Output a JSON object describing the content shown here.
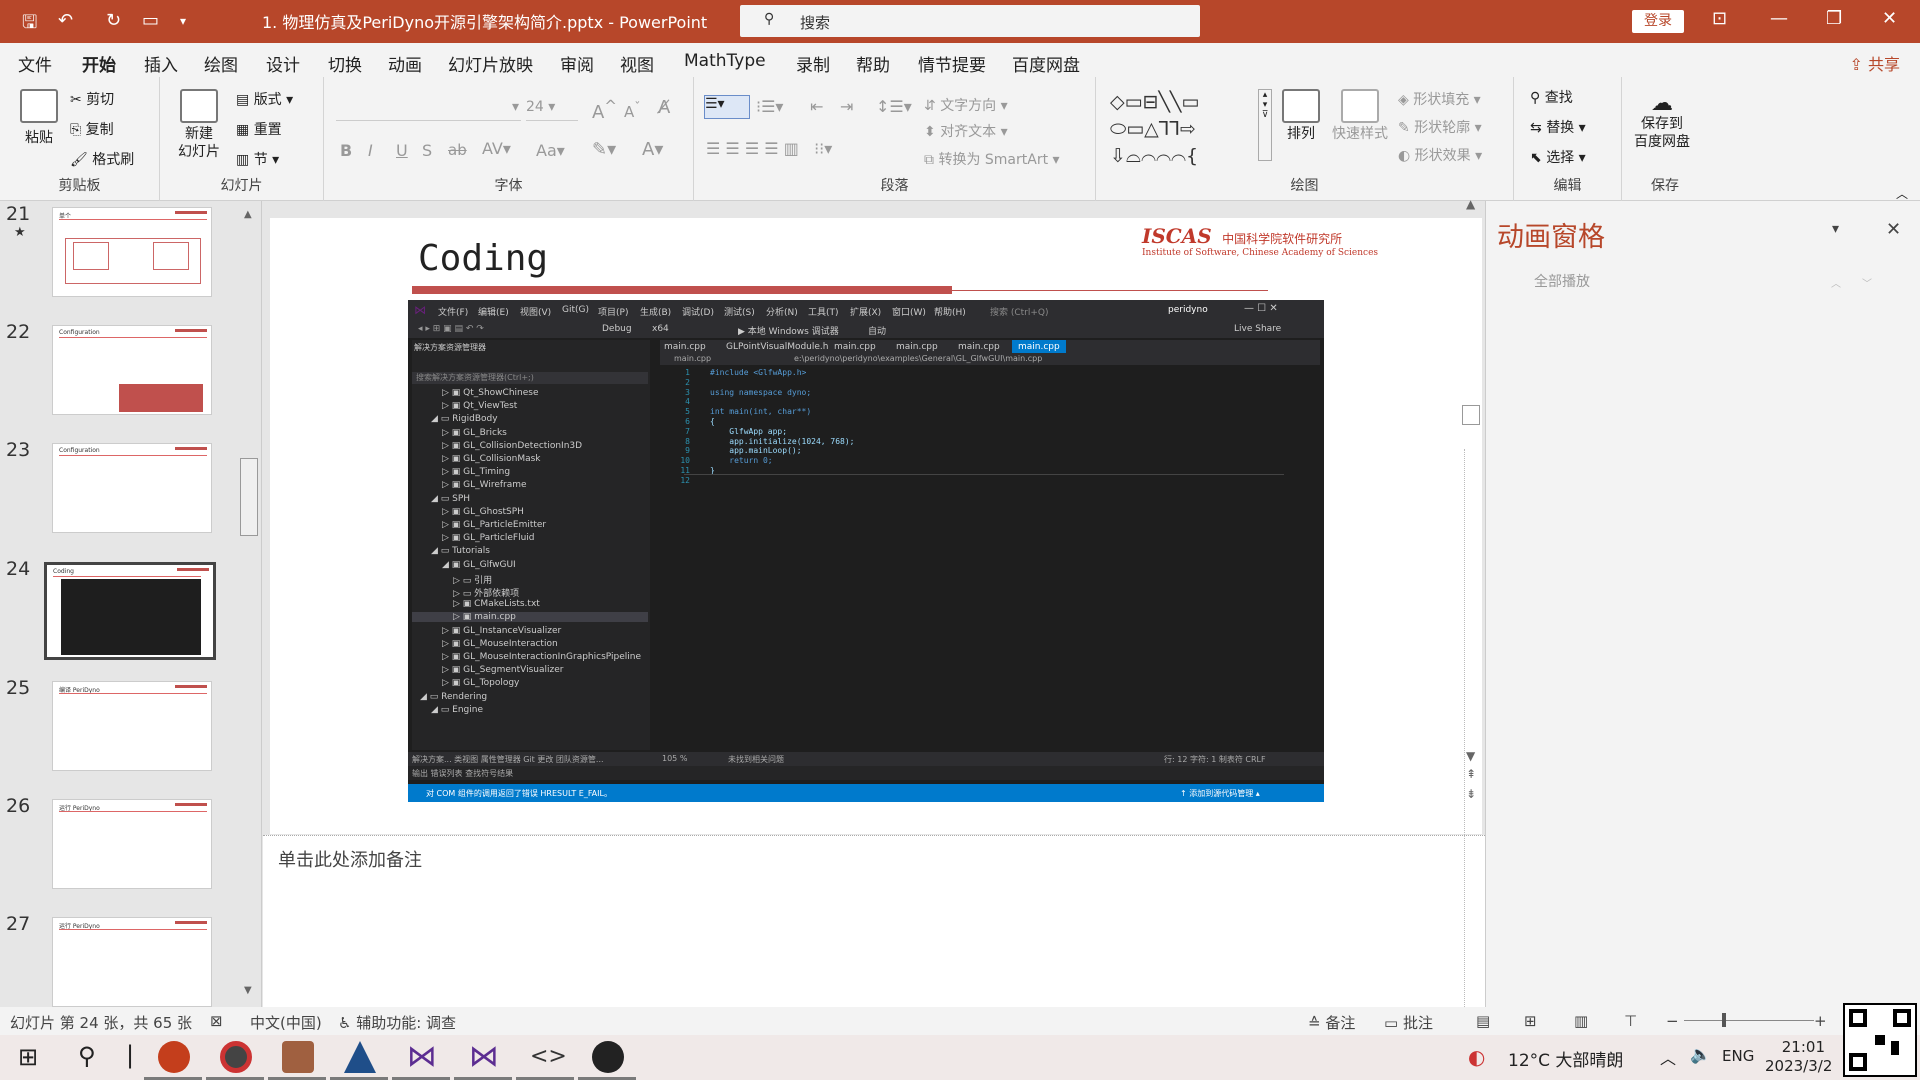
{
  "window": {
    "title": "1. 物理仿真及PeriDyno开源引擎架构简介.pptx - PowerPoint",
    "search_placeholder": "搜索",
    "login_label": "登录",
    "quick_access_icons": [
      "save-icon",
      "undo-icon",
      "redo-icon",
      "present-icon",
      "customize-icon"
    ]
  },
  "menu": {
    "items": [
      "文件",
      "开始",
      "插入",
      "绘图",
      "设计",
      "切换",
      "动画",
      "幻灯片放映",
      "审阅",
      "视图",
      "MathType",
      "录制",
      "帮助",
      "情节提要",
      "百度网盘"
    ],
    "active": "开始",
    "share_label": "共享"
  },
  "ribbon": {
    "clipboard": {
      "label": "剪贴板",
      "paste": "粘贴",
      "cut": "剪切",
      "copy": "复制",
      "format_painter": "格式刷"
    },
    "slides": {
      "label": "幻灯片",
      "new_slide": "新建\n幻灯片",
      "layout": "版式",
      "reset": "重置",
      "section": "节"
    },
    "font": {
      "label": "字体",
      "font_size": "24",
      "bold": "B",
      "italic": "I",
      "underline": "U",
      "shadow": "S",
      "strike": "ab",
      "spacing": "AV",
      "case": "Aa"
    },
    "paragraph": {
      "label": "段落",
      "text_direction": "文字方向",
      "align_text": "对齐文本",
      "smartart": "转换为 SmartArt"
    },
    "drawing": {
      "label": "绘图",
      "arrange": "排列",
      "quick_styles": "快速样式",
      "shape_fill": "形状填充",
      "shape_outline": "形状轮廓",
      "shape_effects": "形状效果"
    },
    "editing": {
      "label": "编辑",
      "find": "查找",
      "replace": "替换",
      "select": "选择"
    },
    "save": {
      "label": "保存",
      "save_to_baidu": "保存到\n百度网盘"
    }
  },
  "thumbnails": [
    {
      "number": "21",
      "starred": "★",
      "title": "单个"
    },
    {
      "number": "22",
      "title": "Configuration"
    },
    {
      "number": "23",
      "title": "Configuration"
    },
    {
      "number": "24",
      "title": "Coding",
      "selected": true
    },
    {
      "number": "25",
      "title": "编译 PeriDyno"
    },
    {
      "number": "26",
      "title": "运行 PeriDyno"
    },
    {
      "number": "27",
      "title": "运行 PeriDyno"
    }
  ],
  "slide": {
    "title": "Coding",
    "logo_text": "ISCAS",
    "logo_cn": "中国科学院软件研究所",
    "logo_en": "Institute of Software, Chinese Academy of Sciences"
  },
  "vs": {
    "menu": [
      "文件(F)",
      "编辑(E)",
      "视图(V)",
      "Git(G)",
      "项目(P)",
      "生成(B)",
      "调试(D)",
      "测试(S)",
      "分析(N)",
      "工具(T)",
      "扩展(X)",
      "窗口(W)",
      "帮助(H)"
    ],
    "search": "搜索 (Ctrl+Q)",
    "solution": "peridyno",
    "config": "Debug",
    "platform": "x64",
    "run": "本地 Windows 调试器",
    "auto": "自动",
    "live_share": "Live Share",
    "explorer_title": "解决方案资源管理器",
    "explorer_search": "搜索解决方案资源管理器(Ctrl+;)",
    "tree": [
      {
        "label": "Qt_ShowChinese",
        "depth": 2
      },
      {
        "label": "Qt_ViewTest",
        "depth": 2
      },
      {
        "label": "RigidBody",
        "depth": 1
      },
      {
        "label": "GL_Bricks",
        "depth": 2
      },
      {
        "label": "GL_CollisionDetectionIn3D",
        "depth": 2
      },
      {
        "label": "GL_CollisionMask",
        "depth": 2
      },
      {
        "label": "GL_Timing",
        "depth": 2
      },
      {
        "label": "GL_Wireframe",
        "depth": 2
      },
      {
        "label": "SPH",
        "depth": 1
      },
      {
        "label": "GL_GhostSPH",
        "depth": 2
      },
      {
        "label": "GL_ParticleEmitter",
        "depth": 2
      },
      {
        "label": "GL_ParticleFluid",
        "depth": 2
      },
      {
        "label": "Tutorials",
        "depth": 1
      },
      {
        "label": "GL_GlfwGUI",
        "depth": 2
      },
      {
        "label": "引用",
        "depth": 3
      },
      {
        "label": "外部依赖项",
        "depth": 3
      },
      {
        "label": "CMakeLists.txt",
        "depth": 3
      },
      {
        "label": "main.cpp",
        "depth": 3
      },
      {
        "label": "GL_InstanceVisualizer",
        "depth": 2
      },
      {
        "label": "GL_MouseInteraction",
        "depth": 2
      },
      {
        "label": "GL_MouseInteractionInGraphicsPipeline",
        "depth": 2
      },
      {
        "label": "GL_SegmentVisualizer",
        "depth": 2
      },
      {
        "label": "GL_Topology",
        "depth": 2
      },
      {
        "label": "Rendering",
        "depth": 0
      },
      {
        "label": "Engine",
        "depth": 1
      }
    ],
    "tabs": [
      "main.cpp",
      "GLPointVisualModule.h",
      "main.cpp",
      "main.cpp",
      "main.cpp",
      "main.cpp"
    ],
    "file_path": "e:\\peridyno\\peridyno\\examples\\General\\GL_GlfwGUI\\main.cpp",
    "file_scope": "main.cpp",
    "code": [
      {
        "n": "1",
        "t": "#include <GlfwApp.h>"
      },
      {
        "n": "2",
        "t": ""
      },
      {
        "n": "3",
        "t": "using namespace dyno;"
      },
      {
        "n": "4",
        "t": ""
      },
      {
        "n": "5",
        "t": "int main(int, char**)"
      },
      {
        "n": "6",
        "t": "{"
      },
      {
        "n": "7",
        "t": "    GlfwApp app;"
      },
      {
        "n": "8",
        "t": "    app.initialize(1024, 768);"
      },
      {
        "n": "9",
        "t": "    app.mainLoop();"
      },
      {
        "n": "10",
        "t": "    return 0;"
      },
      {
        "n": "11",
        "t": "}"
      },
      {
        "n": "12",
        "t": ""
      }
    ],
    "bottom_tabs": "解决方案... 类视图 属性管理器 Git 更改 团队资源管...",
    "zoom": "105 %",
    "no_issues": "未找到相关问题",
    "line_info": "行: 12   字符: 1   制表符   CRLF",
    "output_tabs": "输出  错误列表  查找符号结果",
    "status_msg": "对 COM 组件的调用返回了错误 HRESULT E_FAIL。",
    "source_control": "添加到源代码管理"
  },
  "notes_placeholder": "单击此处添加备注",
  "animation_pane": {
    "title": "动画窗格",
    "play_all": "全部播放"
  },
  "status": {
    "slide_info": "幻灯片 第 24 张，共 65 张",
    "language": "中文(中国)",
    "accessibility": "辅助功能: 调查",
    "notes": "备注",
    "comments": "批注"
  },
  "taskbar": {
    "weather": "12°C  大部晴朗",
    "lang": "ENG",
    "time": "21:01",
    "date": "2023/3/2"
  },
  "colors": {
    "accent": "#b7472a",
    "slide_red": "#c0504d",
    "vs_blue": "#007acc"
  }
}
